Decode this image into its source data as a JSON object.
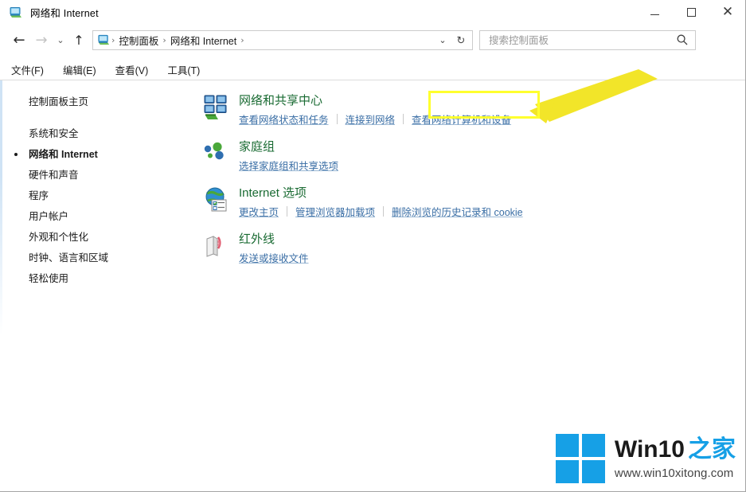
{
  "window": {
    "title": "网络和 Internet",
    "title_icon": "network-folder-icon",
    "minimize_label": "最小化",
    "maximize_label": "最大化",
    "close_label": "关闭"
  },
  "navbar": {
    "back_icon": "back-arrow-icon",
    "forward_icon": "forward-arrow-icon",
    "recent_icon": "chevron-down-icon",
    "up_icon": "up-arrow-icon",
    "address_icon": "control-panel-icon",
    "breadcrumbs": [
      "控制面板",
      "网络和 Internet"
    ],
    "separator": "›",
    "dropdown_icon": "chevron-down-icon",
    "refresh_icon": "refresh-icon"
  },
  "search": {
    "placeholder": "搜索控制面板",
    "value": "",
    "icon": "search-icon"
  },
  "menubar": {
    "items": [
      {
        "label": "文件(F)"
      },
      {
        "label": "编辑(E)"
      },
      {
        "label": "查看(V)"
      },
      {
        "label": "工具(T)"
      }
    ]
  },
  "sidebar": {
    "home": "控制面板主页",
    "items": [
      {
        "label": "系统和安全",
        "active": false
      },
      {
        "label": "网络和 Internet",
        "active": true
      },
      {
        "label": "硬件和声音",
        "active": false
      },
      {
        "label": "程序",
        "active": false
      },
      {
        "label": "用户帐户",
        "active": false
      },
      {
        "label": "外观和个性化",
        "active": false
      },
      {
        "label": "时钟、语言和区域",
        "active": false
      },
      {
        "label": "轻松使用",
        "active": false
      }
    ]
  },
  "main": {
    "categories": [
      {
        "icon": "network-sharing-center-icon",
        "title": "网络和共享中心",
        "highlighted": true,
        "links": [
          "查看网络状态和任务",
          "连接到网络",
          "查看网络计算机和设备"
        ]
      },
      {
        "icon": "homegroup-icon",
        "title": "家庭组",
        "highlighted": false,
        "links": [
          "选择家庭组和共享选项"
        ]
      },
      {
        "icon": "internet-options-icon",
        "title": "Internet 选项",
        "highlighted": false,
        "links": [
          "更改主页",
          "管理浏览器加载项",
          "删除浏览的历史记录和 cookie"
        ]
      },
      {
        "icon": "infrared-icon",
        "title": "红外线",
        "highlighted": false,
        "links": [
          "发送或接收文件"
        ]
      }
    ]
  },
  "annotation": {
    "highlight_color": "#ffff2e",
    "arrow_color": "#f2e529",
    "arrow_icon": "pointer-arrow-icon"
  },
  "watermark": {
    "logo_icon": "windows-logo-icon",
    "brand_en": "Win10",
    "brand_cn": "之家",
    "url": "www.win10xitong.com",
    "accent_color": "#16a0e6"
  },
  "colors": {
    "heading_green": "#1a6b33",
    "link_blue": "#3a6ea5",
    "chrome_border": "#cccccc"
  }
}
